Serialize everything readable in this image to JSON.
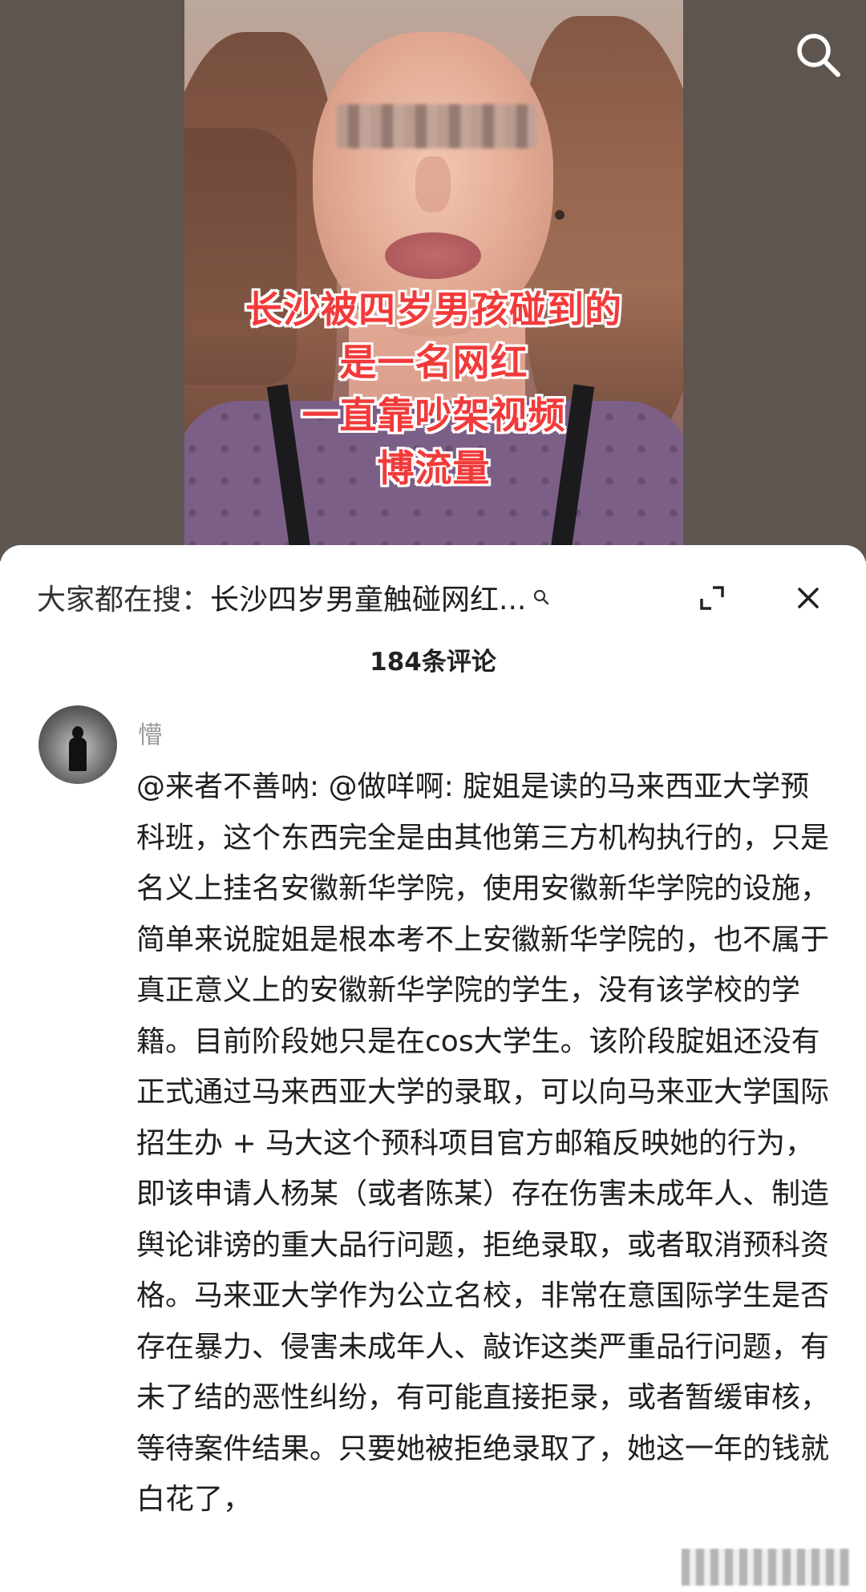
{
  "video": {
    "caption_lines": [
      "长沙被四岁男孩碰到的",
      "是一名网红",
      "一直靠吵架视频",
      "博流量"
    ]
  },
  "comments_panel": {
    "hot_search_prefix": "大家都在搜：",
    "hot_search_term": "长沙四岁男童触碰网红...",
    "comment_count": "184条评论"
  },
  "comment": {
    "username": "懵",
    "text": "@来者不善呐: @做咩啊: 腚姐是读的马来西亚大学预科班，这个东西完全是由其他第三方机构执行的，只是名义上挂名安徽新华学院，使用安徽新华学院的设施，简单来说腚姐是根本考不上安徽新华学院的，也不属于真正意义上的安徽新华学院的学生，没有该学校的学籍。目前阶段她只是在cos大学生。该阶段腚姐还没有正式通过马来西亚大学的录取，可以向马来亚大学国际招生办 + 马大这个预科项目官方邮箱反映她的行为，即该申请人杨某（或者陈某）存在伤害未成年人、制造舆论诽谤的重大品行问题，拒绝录取，或者取消预科资格。马来亚大学作为公立名校，非常在意国际学生是否存在暴力、侵害未成年人、敲诈这类严重品行问题，有未了结的恶性纠纷，有可能直接拒录，或者暂缓审核，等待案件结果。只要她被拒绝录取了，她这一年的钱就白花了，"
  },
  "icons": {
    "search": "search-icon",
    "expand": "expand-icon",
    "close": "close-icon"
  }
}
